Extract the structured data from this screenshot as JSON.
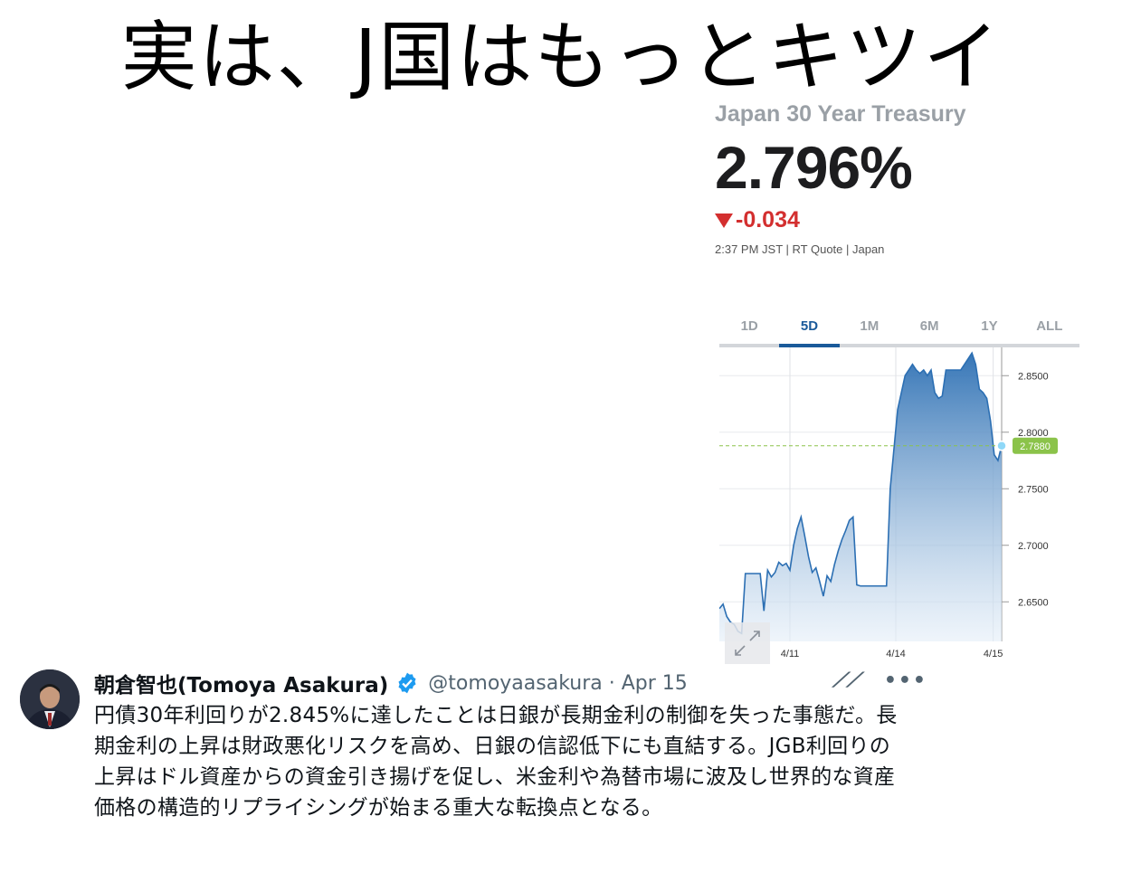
{
  "headline": "実は、J国はもっとキツイ",
  "quote": {
    "instrument": "Japan 30 Year Treasury",
    "price": "2.796%",
    "change": "-0.034",
    "meta": "2:37 PM JST | RT Quote | Japan",
    "direction_icon": "down-triangle-icon",
    "colors": {
      "down": "#d32f2f",
      "accent": "#1a5a9a",
      "line": "#2c6fb3",
      "current_badge": "#8bc34a"
    }
  },
  "tabs": [
    {
      "label": "1D",
      "active": false
    },
    {
      "label": "5D",
      "active": true
    },
    {
      "label": "1M",
      "active": false
    },
    {
      "label": "6M",
      "active": false
    },
    {
      "label": "1Y",
      "active": false
    },
    {
      "label": "ALL",
      "active": false
    }
  ],
  "chart_data": {
    "type": "area",
    "ylim": [
      2.615,
      2.875
    ],
    "y_ticks": [
      "2.8500",
      "2.8000",
      "2.7500",
      "2.7000",
      "2.6500"
    ],
    "x_ticks": [
      "4/11",
      "4/14",
      "4/15"
    ],
    "current_value": "2.7880",
    "grid": true,
    "series": [
      {
        "values": [
          2.644,
          2.648,
          2.637,
          2.632,
          2.63,
          2.624,
          2.622,
          2.675,
          2.675,
          2.675,
          2.675,
          2.675,
          2.642,
          2.678,
          2.672,
          2.676,
          2.685,
          2.682,
          2.684,
          2.678,
          2.7,
          2.715,
          2.725,
          2.708,
          2.69,
          2.676,
          2.68,
          2.668,
          2.655,
          2.673,
          2.668,
          2.683,
          2.695,
          2.705,
          2.713,
          2.722,
          2.725,
          2.665,
          2.664,
          2.664,
          2.664,
          2.664,
          2.664,
          2.664,
          2.664,
          2.664,
          2.75,
          2.785,
          2.82,
          2.835,
          2.85,
          2.855,
          2.86,
          2.855,
          2.852,
          2.855,
          2.85,
          2.855,
          2.835,
          2.83,
          2.832,
          2.855,
          2.855,
          2.855,
          2.855,
          2.855,
          2.86,
          2.865,
          2.87,
          2.86,
          2.838,
          2.835,
          2.83,
          2.81,
          2.78,
          2.775,
          2.788
        ]
      }
    ]
  },
  "tweet": {
    "author": "朝倉智也(Tomoya Asakura)",
    "handle_date": "@tomoyaasakura · Apr 15",
    "text": "円債30年利回りが2.845%に達したことは日銀が長期金利の制御を失った事態だ。長期金利の上昇は財政悪化リスクを高め、日銀の信認低下にも直結する。JGB利回りの上昇はドル資産からの資金引き揚げを促し、米金利や為替市場に波及し世界的な資産価格の構造的リプライシングが始まる重大な転換点となる。",
    "verified_color": "#1d9bf0"
  }
}
